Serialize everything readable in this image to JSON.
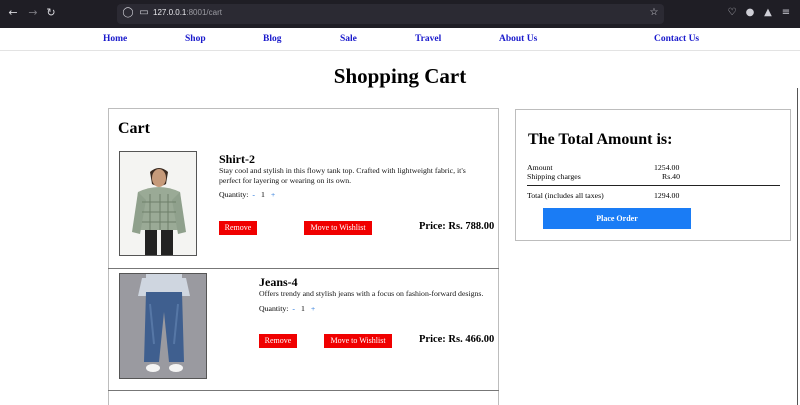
{
  "browser": {
    "url_host": "127.0.0.1",
    "url_rest": ":8001/cart",
    "icons": [
      "back-icon",
      "forward-icon",
      "reload-icon",
      "shield-icon",
      "page-icon",
      "bookmark-star-icon",
      "pocket-icon",
      "account-icon",
      "extensions-icon",
      "menu-icon"
    ]
  },
  "nav": {
    "items": [
      "Home",
      "Shop",
      "Blog",
      "Sale",
      "Travel",
      "About Us",
      "Contact Us"
    ]
  },
  "page": {
    "title": "Shopping Cart"
  },
  "cart": {
    "heading": "Cart",
    "items": [
      {
        "name": "Shirt-2",
        "description_1": "Stay cool and stylish in this flowy tank top. Crafted with lightweight fabric, it's",
        "description_2": "perfect for layering or wearing on its own.",
        "quantity_label": "Quantity:",
        "decrement": "-",
        "quantity": "1",
        "increment": "+",
        "remove_label": "Remove",
        "wishlist_label": "Move to Wishlist",
        "price": "Price: Rs. 788.00"
      },
      {
        "name": "Jeans-4",
        "description_1": "Offers trendy and stylish jeans with a focus on fashion-forward designs.",
        "quantity_label": "Quantity:",
        "decrement": "-",
        "quantity": "1",
        "increment": "+",
        "remove_label": "Remove",
        "wishlist_label": "Move to Wishlist",
        "price": "Price: Rs. 466.00"
      }
    ]
  },
  "summary": {
    "title": "The Total Amount is:",
    "amount_label": "Amount",
    "amount_value": "1254.00",
    "shipping_label": "Shipping charges",
    "shipping_value": "Rs.40",
    "total_label": "Total (includes all taxes)",
    "total_value": "1294.00",
    "place_order_label": "Place Order"
  },
  "colors": {
    "nav_link": "#1a1acc",
    "button_red": "#f00000",
    "button_blue": "#1a7cf5",
    "chrome_bg": "#1f1e25"
  }
}
